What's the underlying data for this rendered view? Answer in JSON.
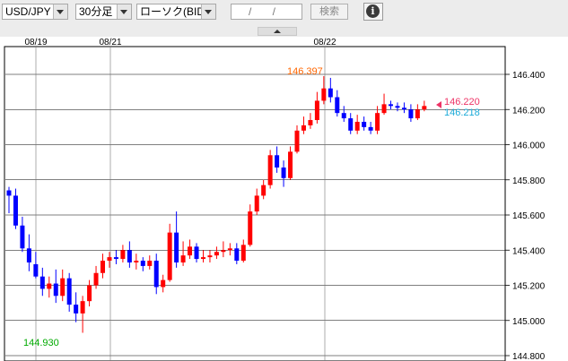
{
  "toolbar": {
    "pair": "USD/JPY",
    "interval": "30分足",
    "chart_type": "ローソク(BID)",
    "date": "/ /",
    "search": "検索",
    "info": "i"
  },
  "colors": {
    "up": "#ff0000",
    "down": "#0000ff",
    "high": "#ff6600",
    "low": "#00aa00",
    "bid": "#ee3366",
    "ask": "#1aaad8"
  },
  "chart_data": {
    "type": "candlestick",
    "y_axis": {
      "ticks": [
        "146.400",
        "146.200",
        "146.000",
        "145.800",
        "145.600",
        "145.400",
        "145.200",
        "145.000",
        "144.800"
      ],
      "ylim": [
        144.8,
        146.4
      ]
    },
    "x_labels": [
      "08/19",
      "08/21",
      "08/22"
    ],
    "grid": true,
    "high_label": "146.397",
    "low_label": "144.930",
    "bid_label": "146.220",
    "ask_label": "146.218",
    "candles": [
      [
        145.74,
        145.71,
        145.76,
        145.61
      ],
      [
        145.71,
        145.54,
        145.75,
        145.52
      ],
      [
        145.54,
        145.41,
        145.59,
        145.39
      ],
      [
        145.41,
        145.33,
        145.49,
        145.28
      ],
      [
        145.32,
        145.25,
        145.39,
        145.24
      ],
      [
        145.25,
        145.18,
        145.3,
        145.14
      ],
      [
        145.18,
        145.21,
        145.25,
        145.13
      ],
      [
        145.21,
        145.14,
        145.29,
        145.1
      ],
      [
        145.14,
        145.24,
        145.29,
        145.11
      ],
      [
        145.24,
        145.09,
        145.27,
        145.05
      ],
      [
        145.09,
        145.04,
        145.16,
        144.99
      ],
      [
        145.04,
        145.11,
        145.14,
        144.93
      ],
      [
        145.11,
        145.2,
        145.23,
        145.08
      ],
      [
        145.2,
        145.27,
        145.31,
        145.18
      ],
      [
        145.27,
        145.34,
        145.38,
        145.24
      ],
      [
        145.34,
        145.36,
        145.39,
        145.3
      ],
      [
        145.36,
        145.35,
        145.4,
        145.32
      ],
      [
        145.35,
        145.4,
        145.43,
        145.33
      ],
      [
        145.4,
        145.33,
        145.45,
        145.3
      ],
      [
        145.33,
        145.34,
        145.38,
        145.29
      ],
      [
        145.34,
        145.31,
        145.36,
        145.28
      ],
      [
        145.31,
        145.34,
        145.37,
        145.29
      ],
      [
        145.34,
        145.19,
        145.38,
        145.15
      ],
      [
        145.19,
        145.23,
        145.26,
        145.16
      ],
      [
        145.23,
        145.5,
        145.55,
        145.22
      ],
      [
        145.5,
        145.33,
        145.62,
        145.3
      ],
      [
        145.33,
        145.37,
        145.45,
        145.31
      ],
      [
        145.37,
        145.42,
        145.46,
        145.35
      ],
      [
        145.42,
        145.35,
        145.44,
        145.33
      ],
      [
        145.35,
        145.36,
        145.4,
        145.33
      ],
      [
        145.36,
        145.37,
        145.4,
        145.33
      ],
      [
        145.37,
        145.39,
        145.42,
        145.35
      ],
      [
        145.39,
        145.4,
        145.45,
        145.36
      ],
      [
        145.4,
        145.41,
        145.44,
        145.37
      ],
      [
        145.41,
        145.34,
        145.44,
        145.32
      ],
      [
        145.34,
        145.43,
        145.46,
        145.33
      ],
      [
        145.43,
        145.62,
        145.66,
        145.42
      ],
      [
        145.62,
        145.71,
        145.75,
        145.6
      ],
      [
        145.71,
        145.77,
        145.8,
        145.69
      ],
      [
        145.77,
        145.94,
        145.97,
        145.75
      ],
      [
        145.94,
        145.87,
        145.99,
        145.84
      ],
      [
        145.87,
        145.81,
        145.91,
        145.76
      ],
      [
        145.81,
        145.96,
        145.99,
        145.8
      ],
      [
        145.96,
        146.08,
        146.11,
        145.95
      ],
      [
        146.08,
        146.11,
        146.16,
        146.06
      ],
      [
        146.11,
        146.14,
        146.18,
        146.09
      ],
      [
        146.14,
        146.25,
        146.3,
        146.12
      ],
      [
        146.25,
        146.32,
        146.39,
        146.23
      ],
      [
        146.32,
        146.27,
        146.38,
        146.24
      ],
      [
        146.27,
        146.18,
        146.31,
        146.16
      ],
      [
        146.18,
        146.15,
        146.22,
        146.13
      ],
      [
        146.15,
        146.08,
        146.18,
        146.06
      ],
      [
        146.08,
        146.13,
        146.17,
        146.06
      ],
      [
        146.13,
        146.1,
        146.16,
        146.08
      ],
      [
        146.1,
        146.08,
        146.13,
        146.06
      ],
      [
        146.08,
        146.18,
        146.22,
        146.06
      ],
      [
        146.18,
        146.23,
        146.29,
        146.17
      ],
      [
        146.23,
        146.22,
        146.25,
        146.2
      ],
      [
        146.22,
        146.21,
        146.24,
        146.19
      ],
      [
        146.21,
        146.2,
        146.24,
        146.18
      ],
      [
        146.2,
        146.15,
        146.23,
        146.13
      ],
      [
        146.15,
        146.2,
        146.23,
        146.14
      ],
      [
        146.2,
        146.22,
        146.25,
        146.19
      ]
    ]
  }
}
